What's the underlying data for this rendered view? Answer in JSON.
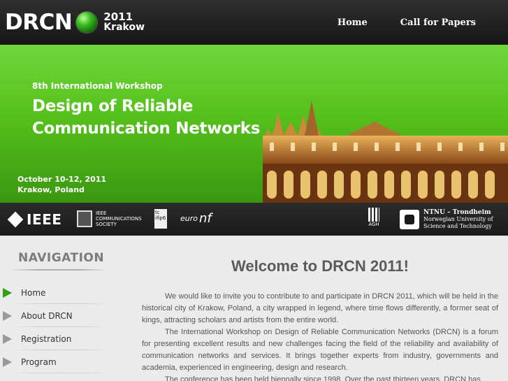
{
  "header": {
    "logo_text": "DRCN",
    "logo_year": "2011",
    "logo_city": "Krakow",
    "nav": [
      {
        "label": "Home"
      },
      {
        "label": "Call for Papers"
      }
    ]
  },
  "banner": {
    "subtitle": "8th International Workshop",
    "title_line1": "Design of Reliable",
    "title_line2": "Communication Networks",
    "date": "October 10-12, 2011",
    "location": "Krakow, Poland"
  },
  "sponsors": {
    "ieee": "IEEE",
    "comsoc_line1": "IEEE",
    "comsoc_line2": "COMMUNICATIONS",
    "comsoc_line3": "SOCIETY",
    "tc_line1": "tc",
    "tc_line2": "ifip6",
    "euronf_small": "euro",
    "euronf_big": "nf",
    "agh": "AGH",
    "ntnu_title": "NTNU – Trondheim",
    "ntnu_line1": "Norwegian University of",
    "ntnu_line2": "Science and Technology"
  },
  "sidebar": {
    "title": "NAVIGATION",
    "items": [
      {
        "label": "Home"
      },
      {
        "label": "About DRCN"
      },
      {
        "label": "Registration"
      },
      {
        "label": "Program"
      }
    ]
  },
  "main": {
    "title": "Welcome to DRCN 2011!",
    "paragraphs": [
      "We would like to invite you to contribute to and participate in DRCN 2011, which will be held in the historical city of Krakow, Poland, a city wrapped in legend, where time flows differently, a former seat of kings, attracting scholars and artists from the entire world.",
      "The International Workshop on Design of Reliable Communication Networks (DRCN) is a forum for presenting excellent results and new challenges facing the field of the reliability and availability of communication networks and services. It brings together experts from industry, governments and academia, experienced in engineering, design and research.",
      "The conference has been held biennally since 1998. Over the past thirteen years, DRCN has"
    ]
  },
  "colors": {
    "banner_green": "#55c11c",
    "active_arrow": "#2ea10c",
    "dark_bar": "#1f1f1f"
  }
}
